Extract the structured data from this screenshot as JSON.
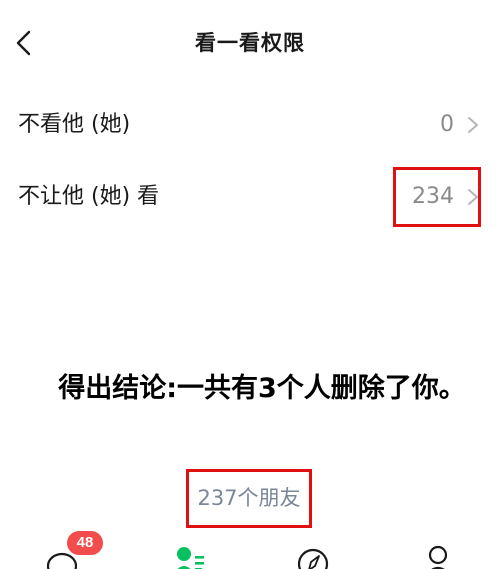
{
  "header": {
    "title": "看一看权限"
  },
  "rows": [
    {
      "label": "不看他 (她)",
      "value": "0"
    },
    {
      "label": "不让他 (她) 看",
      "value": "234"
    }
  ],
  "conclusion": "得出结论:一共有3个人删除了你。",
  "friends": {
    "count_text": "237个朋友"
  },
  "tabbar": {
    "chats_badge": "48",
    "icons": [
      "chat-bubble-icon",
      "contacts-icon",
      "compass-icon",
      "person-icon"
    ],
    "active_color": "#07c160"
  },
  "colors": {
    "highlight": "#e01010",
    "badge": "#f24c4c",
    "muted": "#8a8a8a"
  }
}
